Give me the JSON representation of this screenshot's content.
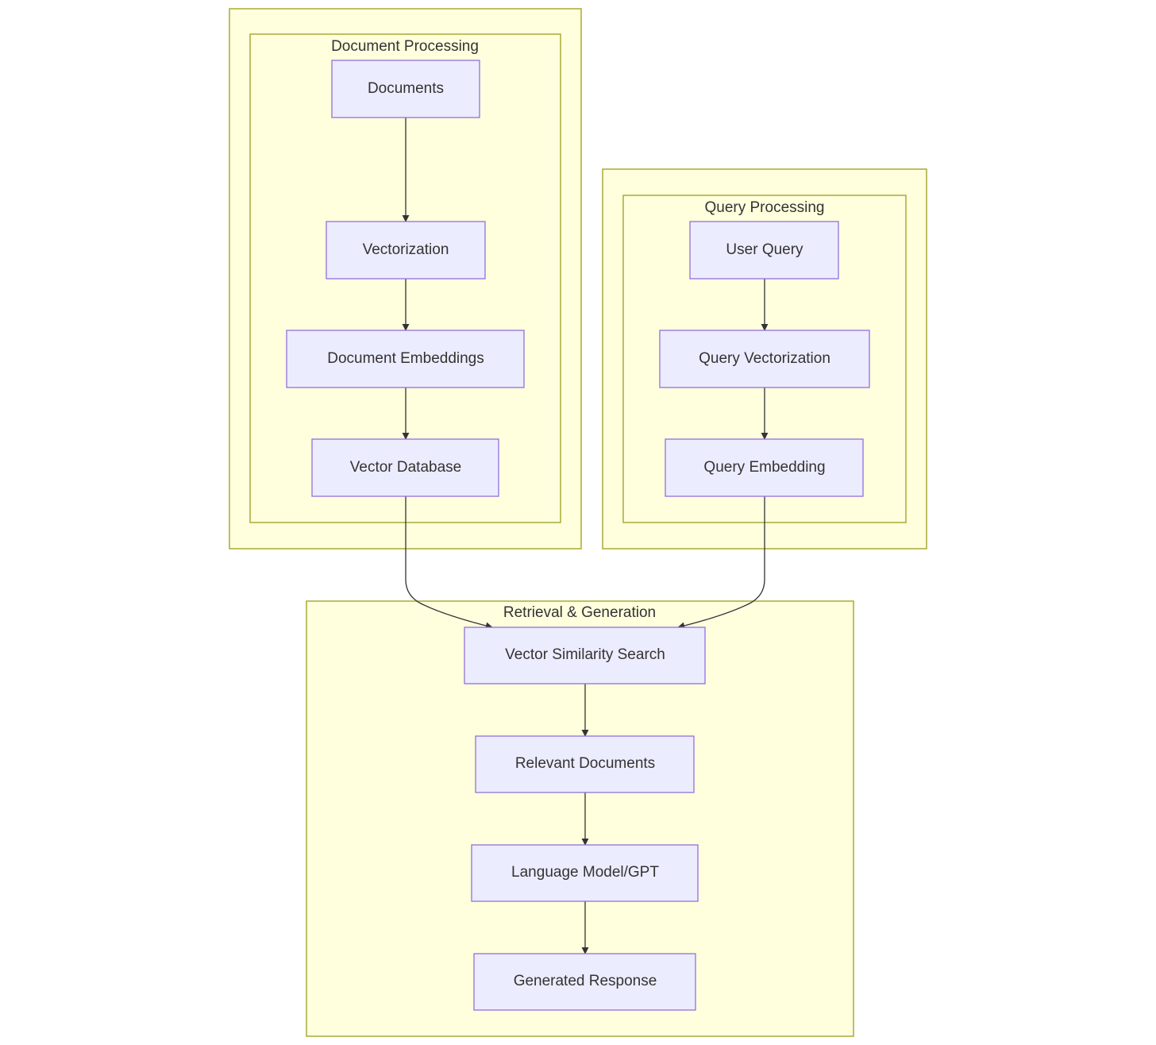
{
  "colors": {
    "cluster_fill": "#ffffde",
    "cluster_stroke": "#aaaa33",
    "node_fill": "#ececff",
    "node_stroke": "#9370db",
    "edge": "#333333",
    "text": "#333333"
  },
  "clusters": {
    "document_processing": "Document Processing",
    "query_processing": "Query Processing",
    "retrieval_generation": "Retrieval & Generation"
  },
  "nodes": {
    "documents": "Documents",
    "vectorization": "Vectorization",
    "document_embeddings": "Document Embeddings",
    "vector_database": "Vector Database",
    "user_query": "User Query",
    "query_vectorization": "Query Vectorization",
    "query_embedding": "Query Embedding",
    "vector_similarity_search": "Vector Similarity Search",
    "relevant_documents": "Relevant Documents",
    "language_model": "Language Model/GPT",
    "generated_response": "Generated Response"
  },
  "edges": [
    [
      "documents",
      "vectorization"
    ],
    [
      "vectorization",
      "document_embeddings"
    ],
    [
      "document_embeddings",
      "vector_database"
    ],
    [
      "user_query",
      "query_vectorization"
    ],
    [
      "query_vectorization",
      "query_embedding"
    ],
    [
      "vector_database",
      "vector_similarity_search"
    ],
    [
      "query_embedding",
      "vector_similarity_search"
    ],
    [
      "vector_similarity_search",
      "relevant_documents"
    ],
    [
      "relevant_documents",
      "language_model"
    ],
    [
      "language_model",
      "generated_response"
    ]
  ]
}
